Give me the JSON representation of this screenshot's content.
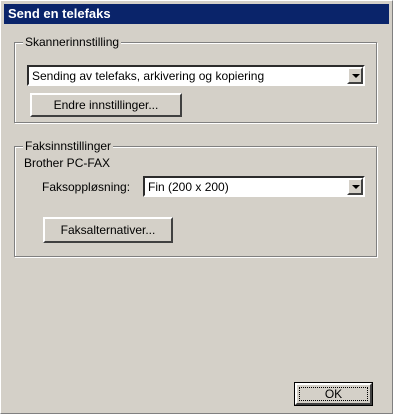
{
  "window": {
    "title": "Send en telefaks"
  },
  "scanner": {
    "group_label": "Skannerinnstilling",
    "mode_selected": "Sending av telefaks, arkivering og kopiering",
    "change_settings_label": "Endre innstillinger..."
  },
  "fax": {
    "group_label": "Faksinnstillinger",
    "device_name": "Brother PC-FAX",
    "resolution_label": "Faksoppløsning:",
    "resolution_selected": "Fin (200 x 200)",
    "options_label": "Faksalternativer..."
  },
  "footer": {
    "ok_label": "OK"
  },
  "colors": {
    "titlebar": "#0a246a",
    "face": "#d4d0c8"
  }
}
